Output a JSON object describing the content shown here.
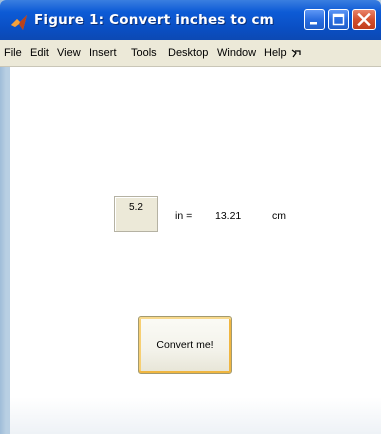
{
  "window": {
    "title": "Figure 1: Convert inches to cm"
  },
  "menu": {
    "items": [
      "File",
      "Edit",
      "View",
      "Insert",
      "Tools",
      "Desktop",
      "Window",
      "Help"
    ]
  },
  "form": {
    "inches_value": "5.2",
    "inches_unit_label": "in =",
    "cm_value": "13.21",
    "cm_unit_label": "cm",
    "convert_button_label": "Convert me!"
  },
  "icons": {
    "app": "matlab-icon",
    "minimize": "minimize-icon",
    "maximize": "maximize-icon",
    "close": "close-icon",
    "overflow": "menu-overflow-icon"
  },
  "colors": {
    "titlebar": "#0a4fc4",
    "menubar": "#ece9d8",
    "close_button": "#d3502e",
    "button_focus": "#f0b640"
  }
}
